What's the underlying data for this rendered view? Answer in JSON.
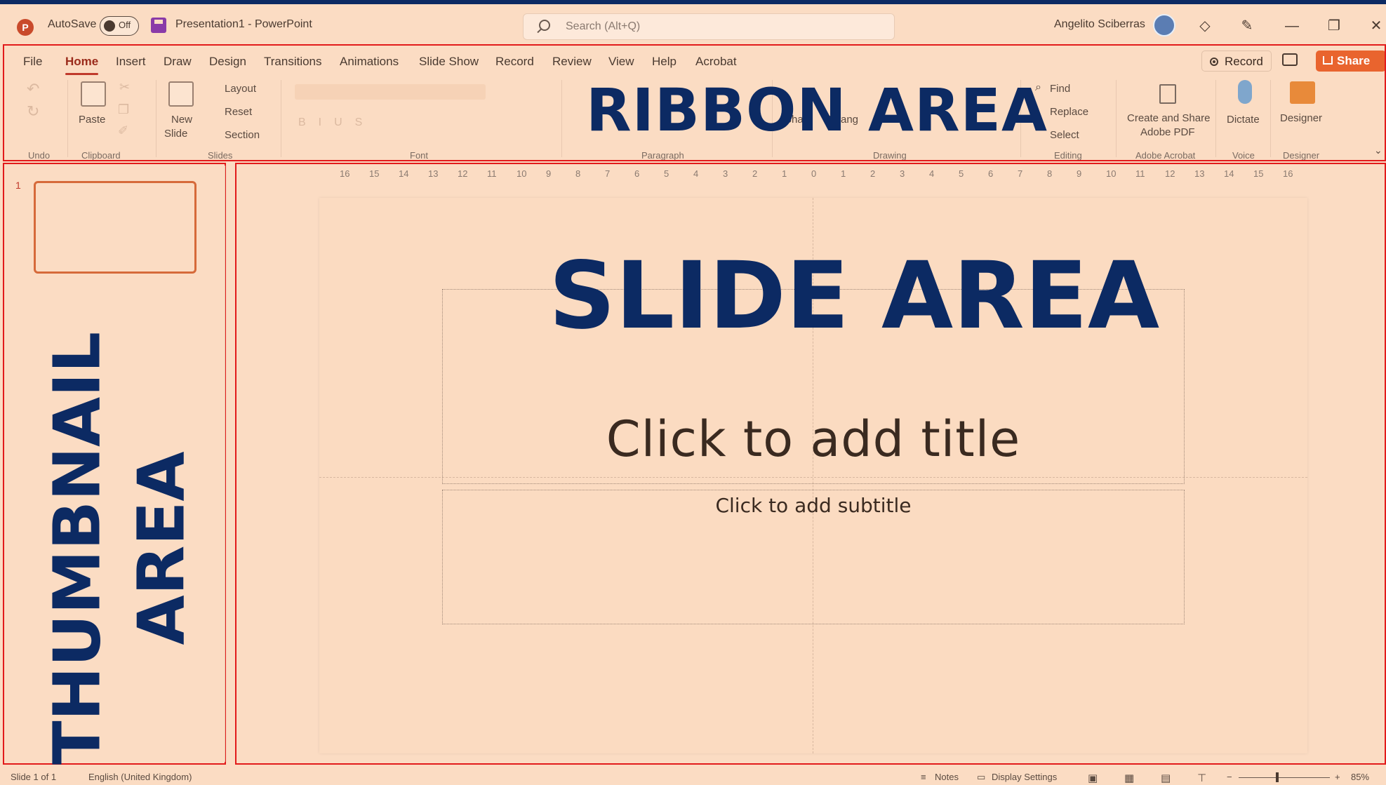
{
  "titlebar": {
    "autosave_label": "AutoSave",
    "autosave_state": "Off",
    "document_title": "Presentation1 - PowerPoint",
    "search_placeholder": "Search (Alt+Q)",
    "user_name": "Angelito Sciberras",
    "minimize_glyph": "—",
    "restore_glyph": "❐",
    "close_glyph": "✕"
  },
  "tabs": [
    "File",
    "Home",
    "Insert",
    "Draw",
    "Design",
    "Transitions",
    "Animations",
    "Slide Show",
    "Record",
    "Review",
    "View",
    "Help",
    "Acrobat"
  ],
  "active_tab": "Home",
  "ribbon_buttons": {
    "record": "Record",
    "share": "Share"
  },
  "ribbon": {
    "paste": "Paste",
    "new_slide_1": "New",
    "new_slide_2": "Slide",
    "layout": "Layout",
    "reset": "Reset",
    "section": "Section",
    "find": "Find",
    "replace": "Replace",
    "select": "Select",
    "create_share_1": "Create and Share",
    "create_share_2": "Adobe PDF",
    "dictate": "Dictate",
    "designer": "Designer",
    "shapes": "Shap",
    "arrange": "Arrang"
  },
  "groups": [
    "Undo",
    "Clipboard",
    "Slides",
    "Font",
    "Paragraph",
    "Drawing",
    "Editing",
    "Adobe Acrobat",
    "Voice",
    "Designer"
  ],
  "ruler_ticks": [
    "16",
    "15",
    "14",
    "13",
    "12",
    "11",
    "10",
    "9",
    "8",
    "7",
    "6",
    "5",
    "4",
    "3",
    "2",
    "1",
    "0",
    "1",
    "2",
    "3",
    "4",
    "5",
    "6",
    "7",
    "8",
    "9",
    "10",
    "11",
    "12",
    "13",
    "14",
    "15",
    "16"
  ],
  "thumbnail": {
    "number": "1"
  },
  "slide": {
    "title_placeholder": "Click to add title",
    "subtitle_placeholder": "Click to add subtitle"
  },
  "annotations": {
    "ribbon": "RIBBON AREA",
    "slide": "SLIDE AREA",
    "thumbnail_line1": "THUMBNAIL",
    "thumbnail_line2": "AREA"
  },
  "statusbar": {
    "slide_count": "Slide 1 of 1",
    "language": "English (United Kingdom)",
    "notes": "Notes",
    "display_settings": "Display Settings",
    "zoom": "85%"
  },
  "colors": {
    "annotation_text": "#0c2a63",
    "frame_red": "#e21b1b",
    "share_orange": "#e9642e",
    "background_peach": "#fbdcc3"
  }
}
